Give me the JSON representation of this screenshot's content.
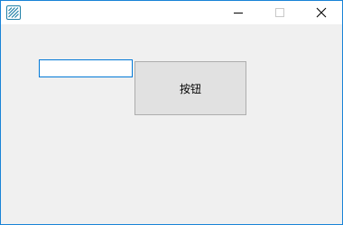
{
  "window": {
    "title": "",
    "accent_color": "#1883d7",
    "icon": "app-logo-icon",
    "controls": {
      "minimize_icon": "minimize-icon",
      "maximize_icon": "maximize-icon",
      "close_icon": "close-icon"
    }
  },
  "form": {
    "textbox_value": "",
    "button_label": "按钮"
  }
}
